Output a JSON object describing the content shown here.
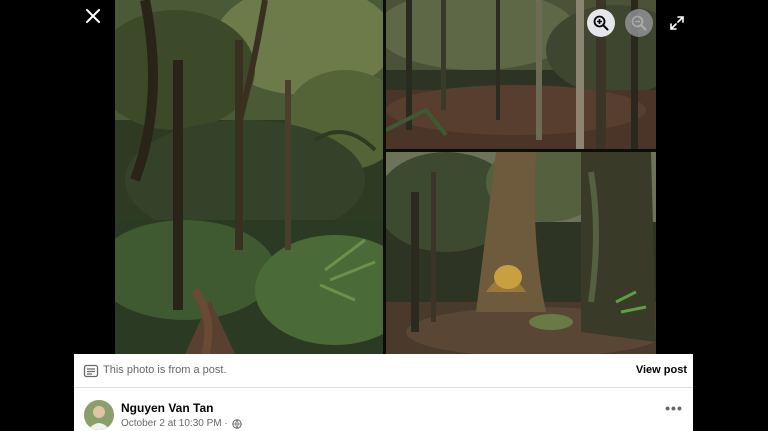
{
  "viewer": {
    "controls": {
      "close_icon": "close-icon",
      "zoom_in_icon": "zoom-in-icon",
      "zoom_out_icon": "zoom-out-icon",
      "fullscreen_icon": "fullscreen-icon"
    },
    "photos": [
      {
        "subject": "forest-path-trees"
      },
      {
        "subject": "forest-slope-trunks"
      },
      {
        "subject": "large-old-tree-trunk"
      }
    ]
  },
  "post_panel": {
    "notice_text": "This photo is from a post.",
    "view_post_label": "View post",
    "author_name": "Nguyen Van Tan",
    "post_date": "October 2 at 10:30 PM ·",
    "more_label": "•••"
  },
  "colors": {
    "background": "#000000",
    "panel": "#ffffff",
    "secondary_text": "#65676b",
    "primary_text": "#050505"
  }
}
